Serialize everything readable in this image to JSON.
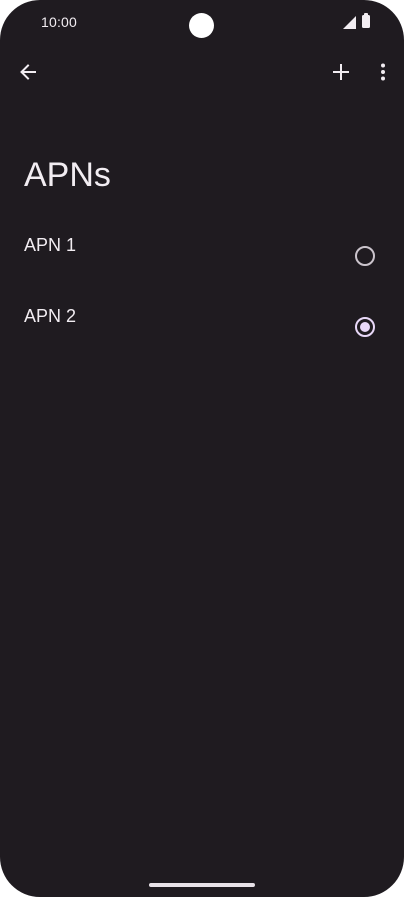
{
  "status_bar": {
    "time": "10:00",
    "icons": [
      "signal-icon",
      "battery-icon"
    ]
  },
  "toolbar": {
    "back_icon": "arrow-back-icon",
    "add_icon": "add-icon",
    "more_icon": "more-vert-icon"
  },
  "page": {
    "title": "APNs"
  },
  "apns": [
    {
      "label": "APN 1",
      "selected": false
    },
    {
      "label": "APN 2",
      "selected": true
    }
  ],
  "colors": {
    "background": "#1f1b20",
    "text": "#f2edf2",
    "accent": "#e8d8f8"
  }
}
